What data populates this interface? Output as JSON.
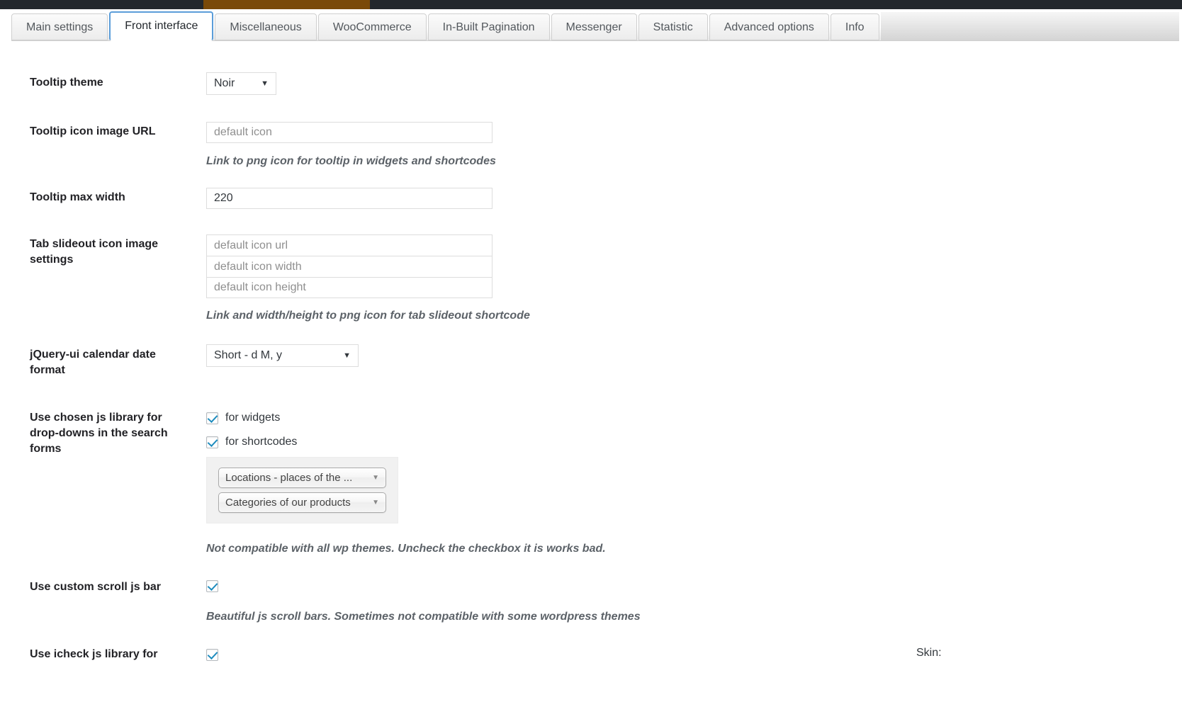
{
  "adminbar": {
    "accent_color": "#7a4a09",
    "bar_color": "#23282d"
  },
  "tabs": [
    {
      "label": "Main settings",
      "active": false
    },
    {
      "label": "Front interface",
      "active": true
    },
    {
      "label": "Miscellaneous",
      "active": false
    },
    {
      "label": "WooCommerce",
      "active": false
    },
    {
      "label": "In-Built Pagination",
      "active": false
    },
    {
      "label": "Messenger",
      "active": false
    },
    {
      "label": "Statistic",
      "active": false
    },
    {
      "label": "Advanced options",
      "active": false
    },
    {
      "label": "Info",
      "active": false
    }
  ],
  "fields": {
    "tooltip_theme": {
      "label": "Tooltip theme",
      "value": "Noir"
    },
    "tooltip_icon_url": {
      "label": "Tooltip icon image URL",
      "value": "",
      "placeholder": "default icon",
      "description": "Link to png icon for tooltip in widgets and shortcodes"
    },
    "tooltip_max_width": {
      "label": "Tooltip max width",
      "value": "220"
    },
    "tab_slideout": {
      "label": "Tab slideout icon image settings",
      "inputs": [
        {
          "value": "",
          "placeholder": "default icon url"
        },
        {
          "value": "",
          "placeholder": "default icon width"
        },
        {
          "value": "",
          "placeholder": "default icon height"
        }
      ],
      "description": "Link and width/height to png icon for tab slideout shortcode"
    },
    "calendar_date_format": {
      "label": "jQuery-ui calendar date format",
      "value": "Short - d M, y"
    },
    "chosen_js": {
      "label": "Use chosen js library for drop-downs in the search forms",
      "checkboxes": [
        {
          "label": "for widgets",
          "checked": true
        },
        {
          "label": "for shortcodes",
          "checked": true
        }
      ],
      "preview_selects": [
        "Locations - places of the ...",
        "Categories of our products"
      ],
      "description": "Not compatible with all wp themes. Uncheck the checkbox it is works bad."
    },
    "custom_scroll": {
      "label": "Use custom scroll js bar",
      "checked": true,
      "description": "Beautiful js scroll bars. Sometimes not compatible with some wordpress themes"
    },
    "icheck_js": {
      "label": "Use icheck js library for",
      "checked": true,
      "skin_label": "Skin:"
    }
  },
  "icons": {
    "caret": "▼"
  }
}
